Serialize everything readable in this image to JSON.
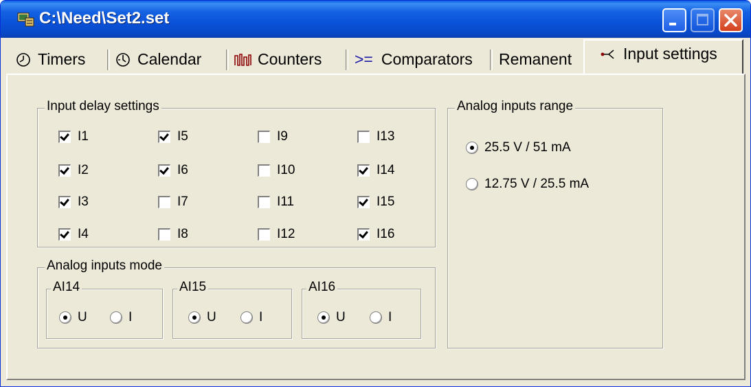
{
  "window": {
    "title": "C:\\Need\\Set2.set"
  },
  "tabs": [
    {
      "label": "Timers",
      "icon": "stopwatch-icon"
    },
    {
      "label": "Calendar",
      "icon": "clock-icon"
    },
    {
      "label": "Counters",
      "icon": "pulse-counter-icon"
    },
    {
      "label": "Comparators",
      "icon": ">="
    },
    {
      "label": "Remanent"
    },
    {
      "label": "Input settings",
      "icon": "input-branch-icon",
      "active": true
    }
  ],
  "input_delay": {
    "title": "Input delay settings",
    "items": [
      {
        "label": "I1",
        "checked": true
      },
      {
        "label": "I5",
        "checked": true
      },
      {
        "label": "I9",
        "checked": false
      },
      {
        "label": "I13",
        "checked": false
      },
      {
        "label": "I2",
        "checked": true
      },
      {
        "label": "I6",
        "checked": true
      },
      {
        "label": "I10",
        "checked": false
      },
      {
        "label": "I14",
        "checked": true
      },
      {
        "label": "I3",
        "checked": true
      },
      {
        "label": "I7",
        "checked": false
      },
      {
        "label": "I11",
        "checked": false
      },
      {
        "label": "I15",
        "checked": true
      },
      {
        "label": "I4",
        "checked": true
      },
      {
        "label": "I8",
        "checked": false
      },
      {
        "label": "I12",
        "checked": false
      },
      {
        "label": "I16",
        "checked": true
      }
    ]
  },
  "analog_mode": {
    "title": "Analog inputs mode",
    "groups": [
      {
        "title": "AI14",
        "u_label": "U",
        "i_label": "I",
        "selected": "U"
      },
      {
        "title": "AI15",
        "u_label": "U",
        "i_label": "I",
        "selected": "U"
      },
      {
        "title": "AI16",
        "u_label": "U",
        "i_label": "I",
        "selected": "U"
      }
    ]
  },
  "analog_range": {
    "title": "Analog inputs range",
    "options": [
      {
        "label": "25.5 V / 51 mA",
        "selected": true
      },
      {
        "label": "12.75 V / 25.5 mA",
        "selected": false
      }
    ]
  }
}
